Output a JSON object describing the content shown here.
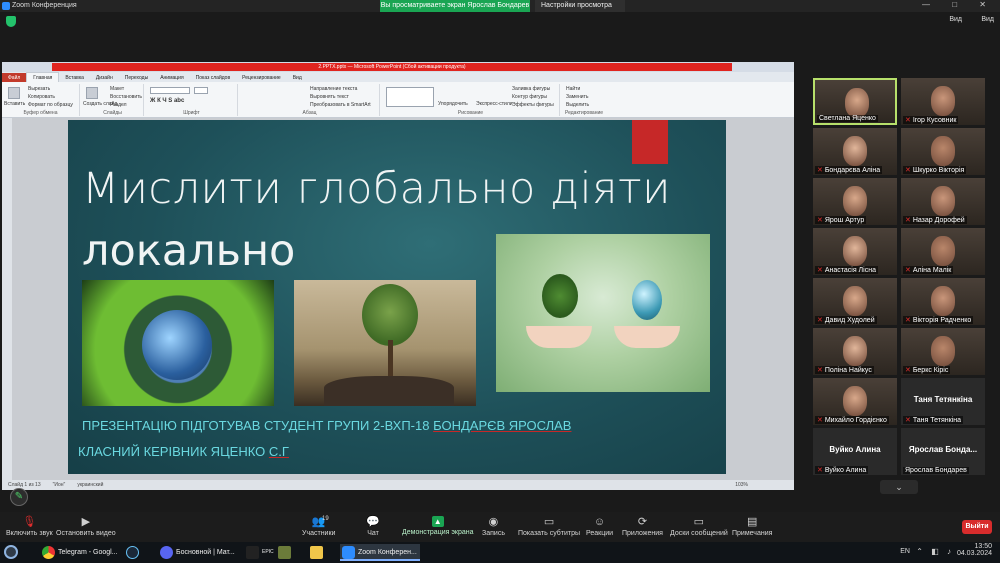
{
  "zoom": {
    "window_title": "Zoom Конференция",
    "share_banner": "Вы просматриваете экран Ярослав Бондарев",
    "view_options": "Настройки просмотра",
    "view_label": "Вид",
    "window_controls": "— □ ✕"
  },
  "ppt": {
    "title": "2.РРТХ.pptx — Microsoft PowerPoint (Сбой активации продукта)",
    "tabs": [
      {
        "label": "Файл"
      },
      {
        "label": "Главная"
      },
      {
        "label": "Вставка"
      },
      {
        "label": "Дизайн"
      },
      {
        "label": "Переходы"
      },
      {
        "label": "Анимация"
      },
      {
        "label": "Показ слайдов"
      },
      {
        "label": "Рецензирование"
      },
      {
        "label": "Вид"
      }
    ],
    "ribbon": {
      "clipboard": {
        "label": "Буфер обмена",
        "paste": "Вставить",
        "cut": "Вырезать",
        "copy": "Копировать",
        "format": "Формат по образцу"
      },
      "slides": {
        "label": "Слайды",
        "new_slide": "Создать слайд",
        "layout": "Макет",
        "reset": "Восстановить",
        "section": "Раздел"
      },
      "font": {
        "label": "Шрифт"
      },
      "paragraph": {
        "label": "Абзац",
        "direction": "Направление текста",
        "align": "Выровнять текст",
        "smartart": "Преобразовать в SmartArt"
      },
      "drawing": {
        "label": "Рисование",
        "arrange": "Упорядочить",
        "styles": "Экспресс-стили",
        "fill": "Заливка фигуры",
        "outline": "Контур фигуры",
        "effects": "Эффекты фигуры"
      },
      "editing": {
        "label": "Редактирование",
        "find": "Найти",
        "replace": "Заменить",
        "select": "Выделить"
      }
    },
    "status": {
      "slide": "Слайд 1 из 13",
      "theme": "\"Ион\"",
      "lang": "украинский",
      "zoom": "103%"
    }
  },
  "slide": {
    "title_line1": "Мислити глобально діяти",
    "title_line2": "локально",
    "subtitle1_a": "ПРЕЗЕНТАЦІЮ ПІДГОТУВАВ СТУДЕНТ ГРУПИ 2-ВХП-18 ",
    "subtitle1_b": "БОНДАРЄВ ЯРОСЛАВ",
    "subtitle2_a": "КЛАСНИЙ КЕРІВНИК ЯЦЕНКО ",
    "subtitle2_b": "С.Г"
  },
  "participants": [
    {
      "name": "Светлана Яценко",
      "muted": false,
      "video": true
    },
    {
      "name": "Ігор Кусовник",
      "muted": true,
      "video": true
    },
    {
      "name": "Бондарєва Аліна",
      "muted": true,
      "video": true
    },
    {
      "name": "Шкурко Вікторія",
      "muted": true,
      "video": true
    },
    {
      "name": "Ярош Артур",
      "muted": true,
      "video": true
    },
    {
      "name": "Назар Дорофей",
      "muted": true,
      "video": true
    },
    {
      "name": "Анастасія Лісна",
      "muted": true,
      "video": true
    },
    {
      "name": "Аліна Малік",
      "muted": true,
      "video": true
    },
    {
      "name": "Давид Худолей",
      "muted": true,
      "video": true
    },
    {
      "name": "Вікторія Радченко",
      "muted": true,
      "video": true
    },
    {
      "name": "Поліна Найкус",
      "muted": true,
      "video": true
    },
    {
      "name": "Беркс Кіріс",
      "muted": true,
      "video": true
    },
    {
      "name": "Михайло Гордієнко",
      "muted": true,
      "video": true
    },
    {
      "name": "Таня Тетянкіна",
      "muted": true,
      "video": false,
      "center": "Таня Тетянкіна"
    },
    {
      "name": "Вуйко Алина",
      "muted": true,
      "video": false,
      "center": "Вуйко Алина"
    },
    {
      "name": "Ярослав Бондарев",
      "muted": false,
      "video": false,
      "center": "Ярослав Бонда..."
    }
  ],
  "more": "⌄",
  "toolbar": {
    "unmute": "Включить звук",
    "stop_video": "Остановить видео",
    "participants": "Участники",
    "participants_count": "19",
    "chat": "Чат",
    "share": "Демонстрация экрана",
    "record": "Запись",
    "captions": "Показать субтитры",
    "reactions": "Реакции",
    "apps": "Приложения",
    "whiteboards": "Доски сообщений",
    "notes": "Примечания",
    "leave": "Выйти"
  },
  "taskbar": {
    "items": [
      {
        "label": "Telegram - Googl..."
      },
      {
        "label": ""
      },
      {
        "label": "Босновной | Мат..."
      },
      {
        "label": "EPIC"
      },
      {
        "label": ""
      },
      {
        "label": ""
      },
      {
        "label": "Zoom Конферен..."
      }
    ],
    "lang": "EN",
    "time": "13:50",
    "date": "04.03.2024"
  },
  "colors": {
    "share_green": "#1aa553",
    "leave_red": "#d82c2c",
    "slide_bg": "#1e5059",
    "slide_accent": "#c62828",
    "subtitle": "#6ad8e0",
    "active_speaker": "#b7e06b"
  }
}
